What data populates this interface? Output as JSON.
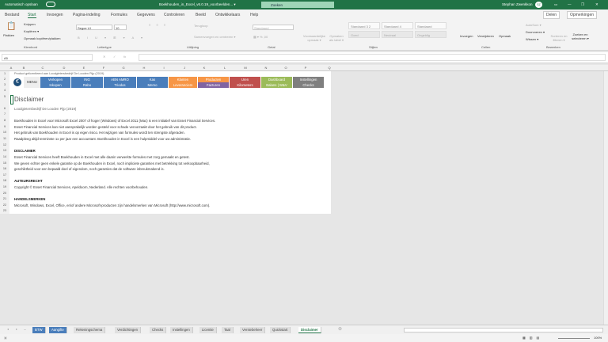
{
  "titlebar": {
    "autosave": "Automatisch opslaan",
    "filename": "Boekhouden_in_Excel_v6.0.19_voorbeelden... ▾",
    "search": "Zoeken",
    "user": "Stephan Zwenkkon",
    "user_initials": "SZ"
  },
  "menu_tabs": [
    "Bestand",
    "Start",
    "Invoegen",
    "Pagina-indeling",
    "Formules",
    "Gegevens",
    "Controleren",
    "Beeld",
    "Ontwikkelaars",
    "Help"
  ],
  "share": "Delen",
  "comments": "Opmerkingen",
  "ribbon": {
    "paste": "Plakken",
    "cut": "Knippen",
    "copy": "Kopiëren ▾",
    "format_painter": "Opmaak kopiëren/plakken",
    "clipboard": "Klembord",
    "font": "Segoe UI",
    "size": "10",
    "font_group": "Lettertype",
    "wrap": "Terugloop",
    "merge": "Samenvoegen en centreren ▾",
    "align_group": "Uitlijning",
    "number_format": "Standaard",
    "number_group": "Getal",
    "cond_format": "Voorwaardelijke opmaak ▾",
    "format_table": "Opmaken als tabel ▾",
    "styles": [
      "Standaard 3 2",
      "Standaard 4",
      "Standaard",
      "Goed",
      "Neutraal",
      "Ongeldig"
    ],
    "styles_group": "Stijlen",
    "insert": "Invoegen",
    "delete": "Verwijderen",
    "format": "Opmaak",
    "cells_group": "Cellen",
    "autosum": "AutoSom ▾",
    "fill": "Doorvoeren ▾",
    "clear": "Wissen ▾",
    "sort": "Sorteren en filteren ▾",
    "find": "Zoeken en selecteren ▾",
    "edit_group": "Bewerken"
  },
  "namebox": "A5",
  "fx": "fx",
  "columns": [
    "A",
    "B",
    "C",
    "D",
    "E",
    "F",
    "G",
    "H",
    "I",
    "J",
    "K",
    "L",
    "M",
    "N",
    "O",
    "P",
    "Q"
  ],
  "rows": [
    "1",
    "2",
    "3",
    "4",
    "5",
    "6",
    "7",
    "8",
    "9",
    "10",
    "11",
    "12",
    "13",
    "14",
    "15",
    "16",
    "17",
    "18",
    "19",
    "20",
    "21",
    "22",
    "23"
  ],
  "header_note": "Product gelicentieerd aan Loodgietersbedrijf De Looden Pijp (2019)",
  "menu_label": "MENU",
  "menu_row1": [
    "Verkopen",
    "ING",
    "ABN AMRO",
    "Kas",
    "Klanten",
    "Producten",
    "Uren",
    "Dashboard",
    "Instellingen"
  ],
  "menu_row2": [
    "Inkopen",
    "Rabo",
    "Triodos",
    "Memo",
    "Leveranciers",
    "Facturen",
    "Kilometers",
    "Balans | W&V",
    "Checks"
  ],
  "colors": {
    "blue": "#4a7ebb",
    "orange": "#f79646",
    "purple": "#8064a2",
    "red": "#c0504d",
    "green": "#9bbb59",
    "gray": "#7f7f7f",
    "excel_green": "#217346"
  },
  "content": {
    "title": "Disclaimer",
    "subtitle": "Loodgietersbedrijf De Looden Pijp (2019)",
    "p1": [
      "Boekhouden in Excel voor Microsoft Excel 2007 of hoger (Windows) of Excel 2011 (Mac) is een initiatief van Esset Financial Services.",
      "Esset Financial Services kan niet aansprakelijk worden gesteld voor schade veroorzaakt door het gebruik van dit product.",
      "Het gebruik van Boekhouden in Excel is op eigen risico. Het wijzigen van formules wordt ten strengste afgeraden.",
      "Raadpleeg altijd tenminste 1x per jaar een accountant. Boekhouden in Excel is een hulpmiddel voor uw administratie."
    ],
    "h1": "DISCLAIMER",
    "p2": [
      "Esset Financial Services heeft Boekhouden in Excel met alle daarin verwerkte formules met zorg gemaakt en getest.",
      "We geven echter geen enkele garantie op de Boekhouden in Excel, noch impliciete garanties met betrekking tot verkoopbaarheid,",
      "geschiktheid voor een bepaald doel of eigendom, noch garanties dat de software inbreukmakend is."
    ],
    "h2": "AUTEURSRECHT",
    "p3": "Copyright © Esset Financial Services, Apeldoorn, Nederland. Alle rechten voorbehouden.",
    "h3": "HANDELSMERKEN",
    "p4": "Microsoft, Windows, Excel, Office, en/of andere Microsoft-producten zijn handelsmerken van Microsoft (http://www.microsoft.com)."
  },
  "sheet_tabs": [
    "BTW",
    "Aangifte",
    "Rekeningschema",
    "Verdichtingen",
    "Checks",
    "Instellingen",
    "Licentie",
    "Taal",
    "Versiebeheer",
    "Quickstart",
    "Disclaimer"
  ],
  "ellipsis": "...",
  "zoom": "100%"
}
